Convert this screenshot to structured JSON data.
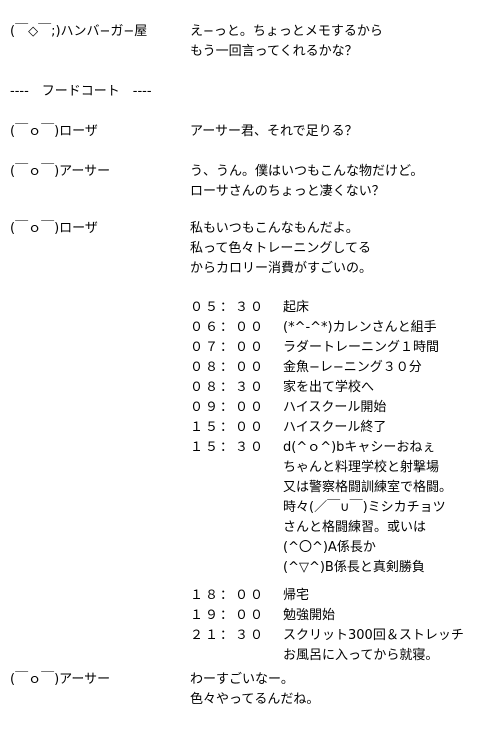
{
  "blocks": [
    {
      "speaker": "(￣◇￣;)ハンバ−ガ−屋",
      "lines": [
        "え−っと。ちょっとメモするから",
        "もう一回言ってくれるかな？"
      ]
    },
    {
      "divider": "----　フードコート　----"
    },
    {
      "speaker": "(￣ｏ￣)ローザ",
      "lines": [
        "アーサー君、それで足りる？"
      ]
    },
    {
      "speaker": "(￣ｏ￣)アーサー",
      "lines": [
        "う、うん。僕はいつもこんな物だけど。",
        "ローサさんのちょっと凄くない？"
      ]
    },
    {
      "speaker": "(￣ｏ￣)ローザ",
      "lines": [
        "私もいつもこんなもんだよ。",
        "私って色々トレーニングしてる",
        "からカロリー消費がすごいの。"
      ]
    }
  ],
  "schedule": [
    {
      "time": "０５：３０",
      "lines": [
        "起床"
      ]
    },
    {
      "time": "０６：００",
      "lines": [
        "(*^-^*)カレンさんと組手"
      ]
    },
    {
      "time": "０７：００",
      "lines": [
        "ラダートレーニング１時間"
      ]
    },
    {
      "time": "０８：００",
      "lines": [
        "金魚−レ−ニング３０分"
      ]
    },
    {
      "time": "０８：３０",
      "lines": [
        "家を出て学校へ"
      ]
    },
    {
      "time": "０９：００",
      "lines": [
        "ハイスクール開始"
      ]
    },
    {
      "time": "１５：００",
      "lines": [
        "ハイスクール終了"
      ]
    },
    {
      "time": "１５：３０",
      "lines": [
        "d(^ｏ^)bキャシーおねぇ",
        "ちゃんと料理学校と射撃場",
        "又は警察格闘訓練室で格闘。",
        "時々(／￣∪￣)ミシカチョツ",
        "さんと格闘練習。或いは",
        "(^〇^)A係長か",
        "(^▽^)B係長と真剣勝負"
      ]
    },
    {
      "time": "１８：００",
      "lines": [
        "帰宅"
      ]
    },
    {
      "time": "１９：００",
      "lines": [
        "勉強開始"
      ]
    },
    {
      "time": "２１：３０",
      "lines": [
        "スクリット300回＆ストレッチ",
        "お風呂に入ってから就寝。"
      ]
    }
  ],
  "closing": {
    "speaker": "(￣ｏ￣)アーサー",
    "lines": [
      "わーすごいなー。",
      "色々やってるんだね。"
    ]
  }
}
